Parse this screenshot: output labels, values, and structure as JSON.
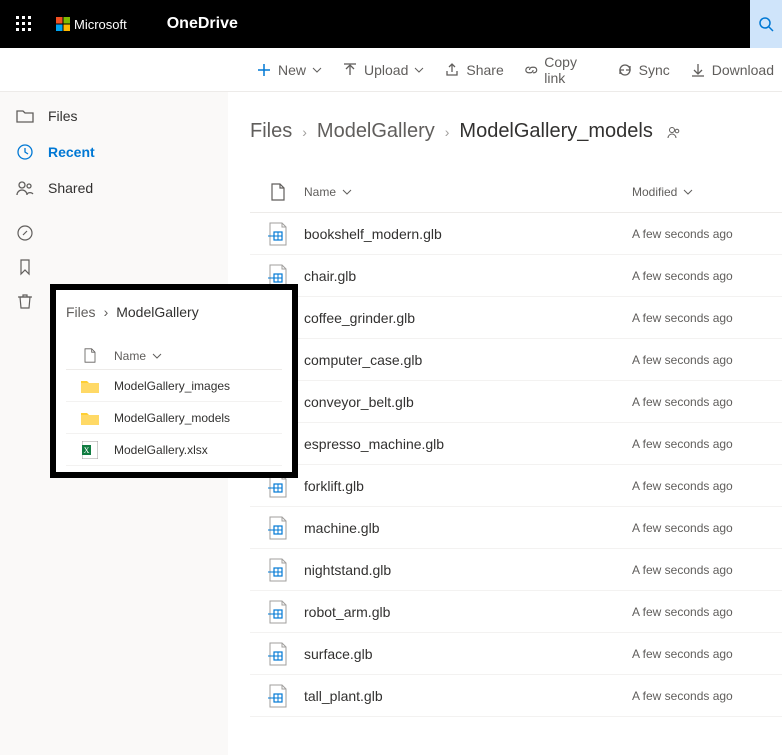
{
  "header": {
    "brand": "Microsoft",
    "app": "OneDrive"
  },
  "toolbar": {
    "new": "New",
    "upload": "Upload",
    "share": "Share",
    "copylink": "Copy link",
    "sync": "Sync",
    "download": "Download"
  },
  "sidebar": {
    "files": "Files",
    "recent": "Recent",
    "shared": "Shared"
  },
  "breadcrumb": {
    "root": "Files",
    "p1": "ModelGallery",
    "current": "ModelGallery_models"
  },
  "columns": {
    "name": "Name",
    "modified": "Modified"
  },
  "files": [
    {
      "name": "bookshelf_modern.glb",
      "modified": "A few seconds ago"
    },
    {
      "name": "chair.glb",
      "modified": "A few seconds ago"
    },
    {
      "name": "coffee_grinder.glb",
      "modified": "A few seconds ago"
    },
    {
      "name": "computer_case.glb",
      "modified": "A few seconds ago"
    },
    {
      "name": "conveyor_belt.glb",
      "modified": "A few seconds ago"
    },
    {
      "name": "espresso_machine.glb",
      "modified": "A few seconds ago"
    },
    {
      "name": "forklift.glb",
      "modified": "A few seconds ago"
    },
    {
      "name": "machine.glb",
      "modified": "A few seconds ago"
    },
    {
      "name": "nightstand.glb",
      "modified": "A few seconds ago"
    },
    {
      "name": "robot_arm.glb",
      "modified": "A few seconds ago"
    },
    {
      "name": "surface.glb",
      "modified": "A few seconds ago"
    },
    {
      "name": "tall_plant.glb",
      "modified": "A few seconds ago"
    }
  ],
  "overlay": {
    "crumb_root": "Files",
    "crumb_current": "ModelGallery",
    "col_name": "Name",
    "items": [
      {
        "name": "ModelGallery_images",
        "type": "folder"
      },
      {
        "name": "ModelGallery_models",
        "type": "folder"
      },
      {
        "name": "ModelGallery.xlsx",
        "type": "xlsx"
      }
    ]
  }
}
